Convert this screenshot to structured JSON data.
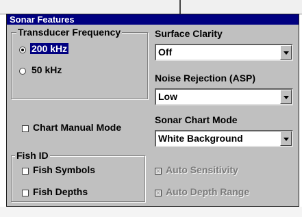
{
  "dialog": {
    "title": "Sonar Features"
  },
  "transducer": {
    "group_label": "Transducer Frequency",
    "options": [
      {
        "label": "200 kHz",
        "selected": true
      },
      {
        "label": "50 kHz",
        "selected": false
      }
    ]
  },
  "surface_clarity": {
    "label": "Surface Clarity",
    "value": "Off"
  },
  "noise_rejection": {
    "label": "Noise Rejection (ASP)",
    "value": "Low"
  },
  "sonar_chart_mode": {
    "label": "Sonar Chart Mode",
    "value": "White Background"
  },
  "chart_manual_mode": {
    "label": "Chart Manual Mode",
    "checked": false
  },
  "fish_id": {
    "group_label": "Fish ID",
    "fish_symbols": {
      "label": "Fish Symbols",
      "checked": false
    },
    "fish_depths": {
      "label": "Fish Depths",
      "checked": false
    }
  },
  "auto_sensitivity": {
    "label": "Auto Sensitivity",
    "checked": true,
    "disabled": true
  },
  "auto_depth_range": {
    "label": "Auto Depth Range",
    "checked": true,
    "disabled": true
  },
  "colors": {
    "titlebar": "#000080",
    "dialog_bg": "#c0c0c0",
    "selection": "#000080"
  },
  "icons": {
    "combo_arrow": "chevron-down-icon"
  }
}
